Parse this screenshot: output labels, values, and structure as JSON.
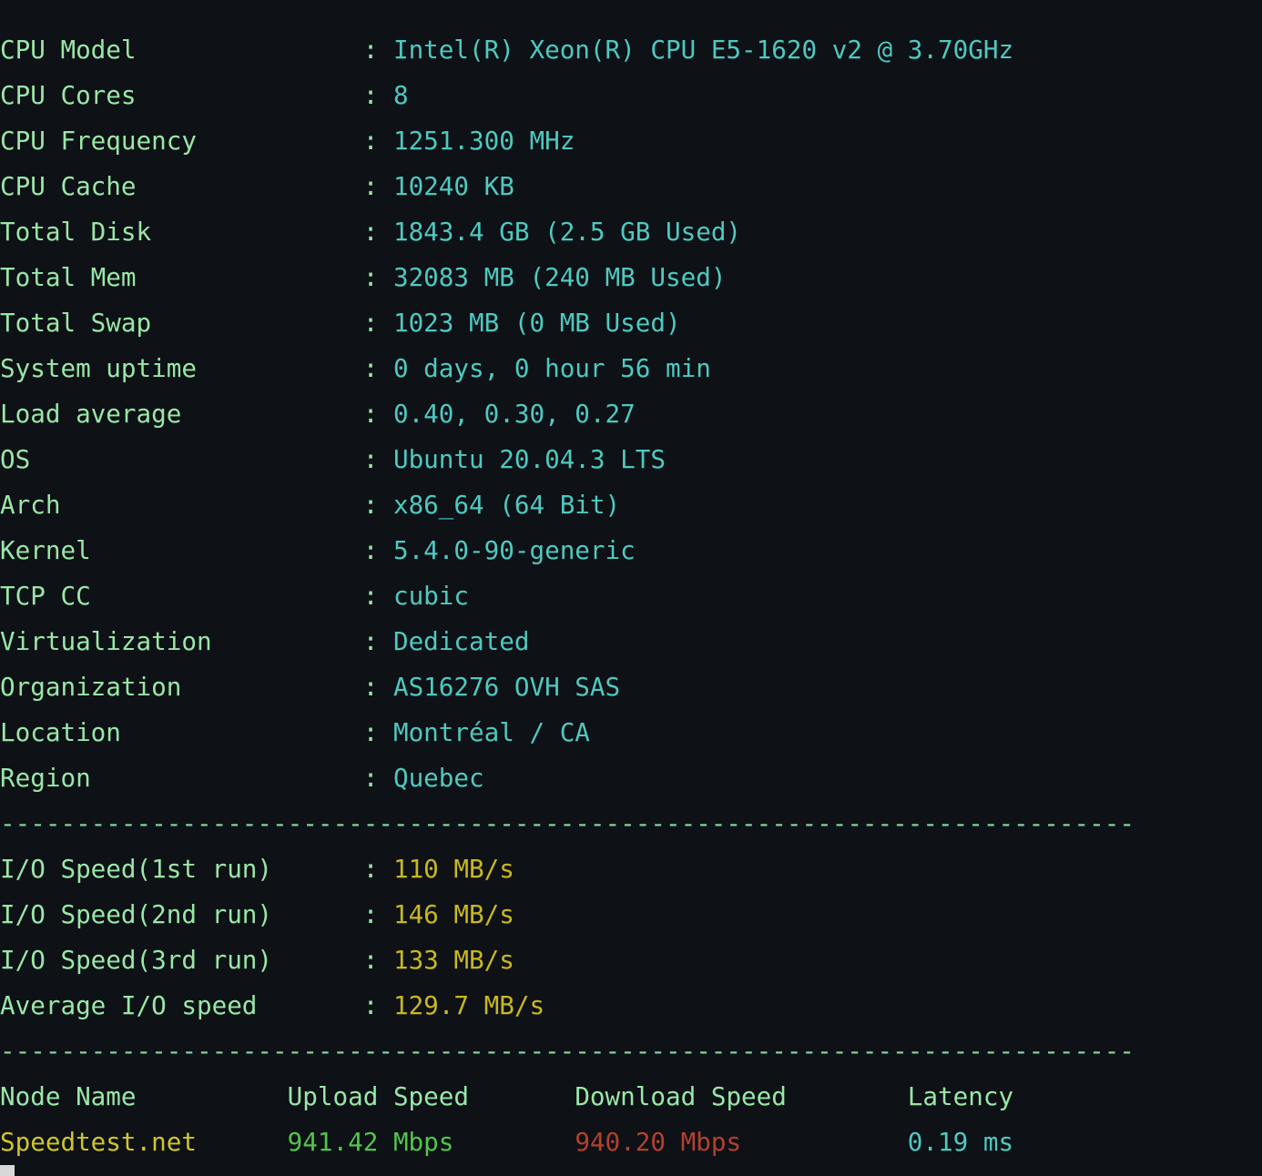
{
  "terminal": {
    "background_color": "#0e1116",
    "label_color": "#99e6a7",
    "value_color": "#4ec9c0",
    "io_value_color": "#c9b820",
    "separator": "---------------------------------------------------------------------------",
    "separator_color": "#7fd69a"
  },
  "system_info": {
    "rows": [
      {
        "label": "CPU Model",
        "value": "Intel(R) Xeon(R) CPU E5-1620 v2 @ 3.70GHz"
      },
      {
        "label": "CPU Cores",
        "value": "8"
      },
      {
        "label": "CPU Frequency",
        "value": "1251.300 MHz"
      },
      {
        "label": "CPU Cache",
        "value": "10240 KB"
      },
      {
        "label": "Total Disk",
        "value": "1843.4 GB (2.5 GB Used)"
      },
      {
        "label": "Total Mem",
        "value": "32083 MB (240 MB Used)"
      },
      {
        "label": "Total Swap",
        "value": "1023 MB (0 MB Used)"
      },
      {
        "label": "System uptime",
        "value": "0 days, 0 hour 56 min"
      },
      {
        "label": "Load average",
        "value": "0.40, 0.30, 0.27"
      },
      {
        "label": "OS",
        "value": "Ubuntu 20.04.3 LTS"
      },
      {
        "label": "Arch",
        "value": "x86_64 (64 Bit)"
      },
      {
        "label": "Kernel",
        "value": "5.4.0-90-generic"
      },
      {
        "label": "TCP CC",
        "value": "cubic"
      },
      {
        "label": "Virtualization",
        "value": "Dedicated"
      },
      {
        "label": "Organization",
        "value": "AS16276 OVH SAS"
      },
      {
        "label": "Location",
        "value": "Montréal / CA"
      },
      {
        "label": "Region",
        "value": "Quebec"
      }
    ]
  },
  "io_speed": {
    "rows": [
      {
        "label": "I/O Speed(1st run)",
        "value": "110 MB/s"
      },
      {
        "label": "I/O Speed(2nd run)",
        "value": "146 MB/s"
      },
      {
        "label": "I/O Speed(3rd run)",
        "value": "133 MB/s"
      },
      {
        "label": "Average I/O speed",
        "value": "129.7 MB/s"
      }
    ]
  },
  "speedtest": {
    "headers": {
      "node_name": "Node Name",
      "upload_speed": "Upload Speed",
      "download_speed": "Download Speed",
      "latency": "Latency"
    },
    "rows": [
      {
        "node_name": "Speedtest.net",
        "upload_speed": "941.42 Mbps",
        "download_speed": "940.20 Mbps",
        "latency": "0.19 ms",
        "node_color": "#cfc62a",
        "upload_color": "#53c44b",
        "download_color": "#b3402f",
        "latency_color": "#4ec9c0"
      }
    ]
  }
}
